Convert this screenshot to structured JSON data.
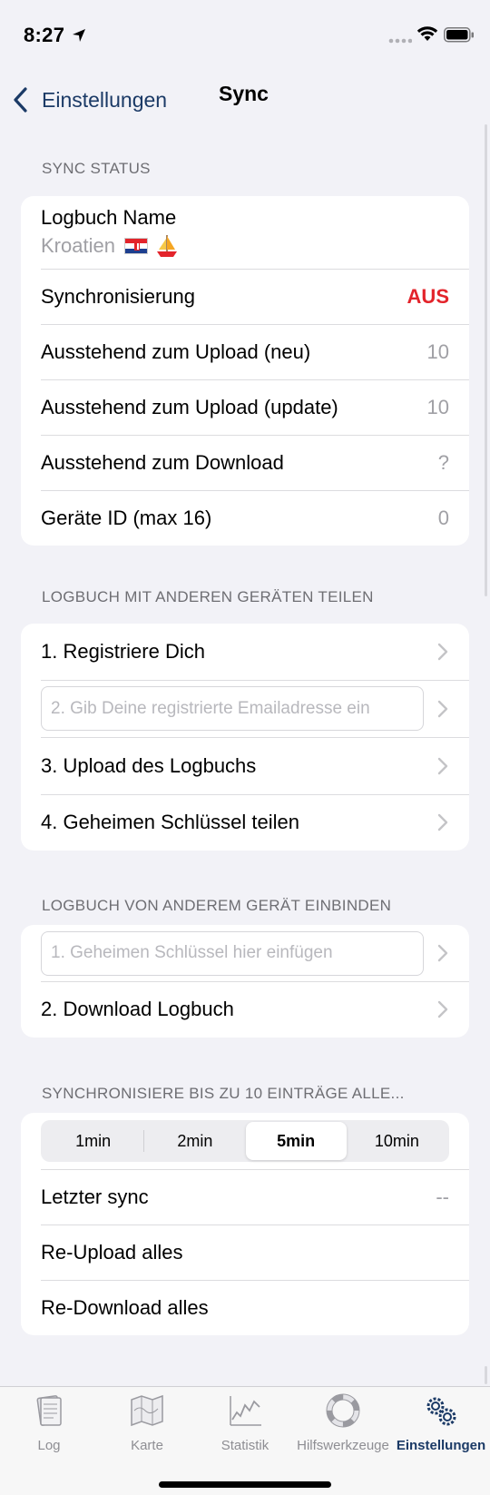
{
  "status_bar": {
    "time": "8:27"
  },
  "nav": {
    "back_label": "Einstellungen",
    "title": "Sync"
  },
  "sync_status": {
    "header": "SYNC STATUS",
    "name_label": "Logbuch Name",
    "name_value": "Kroatien",
    "sync_label": "Synchronisierung",
    "sync_value": "AUS",
    "upload_new_label": "Ausstehend zum Upload (neu)",
    "upload_new_value": "10",
    "upload_update_label": "Ausstehend zum Upload (update)",
    "upload_update_value": "10",
    "download_label": "Ausstehend zum Download",
    "download_value": "?",
    "device_label": "Geräte ID (max 16)",
    "device_value": "0"
  },
  "share": {
    "header": "LOGBUCH MIT ANDEREN GERÄTEN TEILEN",
    "step1": "1. Registriere Dich",
    "step2_placeholder": "2. Gib Deine registrierte Emailadresse ein",
    "step3": "3. Upload des Logbuchs",
    "step4": "4. Geheimen Schlüssel teilen"
  },
  "join": {
    "header": "LOGBUCH VON ANDEREM GERÄT EINBINDEN",
    "step1_placeholder": "1. Geheimen Schlüssel hier einfügen",
    "step2": "2. Download Logbuch"
  },
  "interval": {
    "header": "SYNCHRONISIERE BIS ZU 10 EINTRÄGE ALLE...",
    "options": [
      "1min",
      "2min",
      "5min",
      "10min"
    ],
    "selected": "5min",
    "last_sync_label": "Letzter sync",
    "last_sync_value": "--",
    "reupload_label": "Re-Upload alles",
    "redownload_label": "Re-Download alles"
  },
  "tabs": [
    {
      "label": "Log",
      "icon": "logbook-icon"
    },
    {
      "label": "Karte",
      "icon": "map-icon"
    },
    {
      "label": "Statistik",
      "icon": "chart-icon"
    },
    {
      "label": "Hilfswerkzeuge",
      "icon": "lifebuoy-icon"
    },
    {
      "label": "Einstellungen",
      "icon": "gears-icon"
    }
  ],
  "colors": {
    "accent": "#1b3a66",
    "alert": "#e3242b",
    "background": "#f2f2f7"
  }
}
